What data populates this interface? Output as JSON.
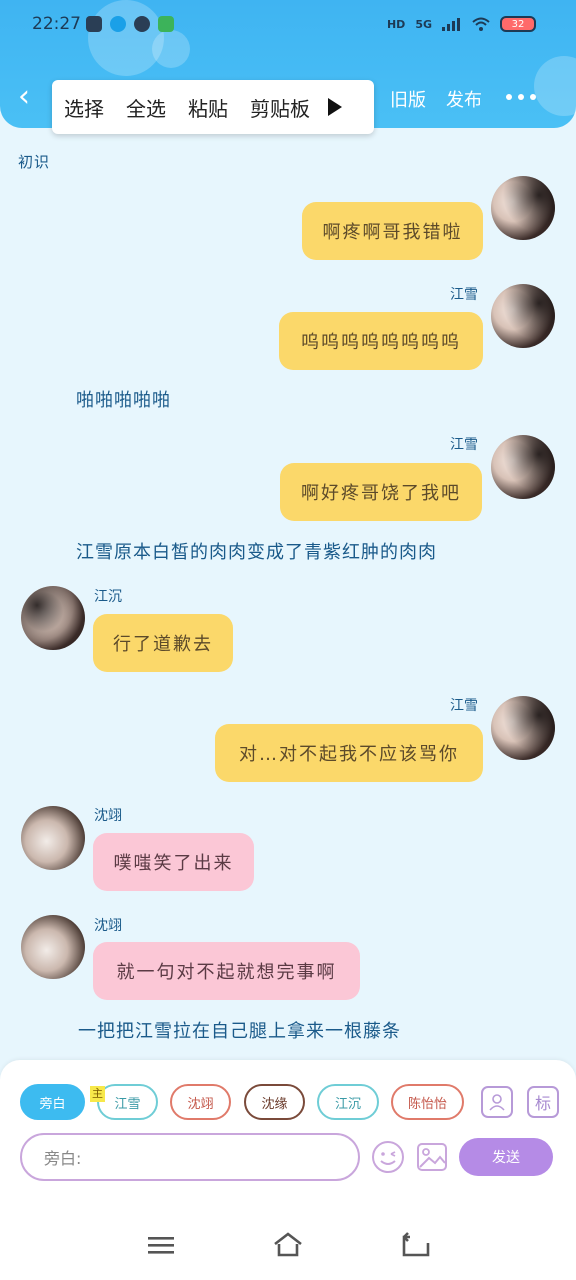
{
  "status": {
    "time": "22:27",
    "hd": "HD",
    "net": "5G",
    "battery": "32"
  },
  "header": {
    "back": "‹",
    "popup_items": [
      "选择",
      "全选",
      "粘贴",
      "剪贴板"
    ],
    "old_version": "旧版",
    "publish": "发布"
  },
  "chat": {
    "tag": "初识",
    "m1": {
      "text": "啊疼啊哥我错啦"
    },
    "m2": {
      "sender": "江雪",
      "text": "呜呜呜呜呜呜呜呜"
    },
    "n1": "啪啪啪啪啪",
    "m3": {
      "sender": "江雪",
      "text": "啊好疼哥饶了我吧"
    },
    "n2": "江雪原本白皙的肉肉变成了青紫红肿的肉肉",
    "m4": {
      "sender": "江沉",
      "text": "行了道歉去"
    },
    "m5": {
      "sender": "江雪",
      "text": "对…对不起我不应该骂你"
    },
    "m6": {
      "sender": "沈翊",
      "text": "噗嗤笑了出来"
    },
    "m7": {
      "sender": "沈翊",
      "text": "就一句对不起就想完事啊"
    },
    "n3": "一把把江雪拉在自己腿上拿来一根藤条"
  },
  "panel": {
    "chips": [
      "旁白",
      "江雪",
      "沈翊",
      "沈缘",
      "江沉",
      "陈怡怡"
    ],
    "main_badge": "主",
    "tag_button": "标",
    "input_placeholder": "旁白:",
    "send": "发送"
  },
  "colors": {
    "header": "#3fb4f2",
    "bubble_yellow": "#fbd86a",
    "bubble_pink": "#fbc7d6",
    "send": "#b58be6"
  }
}
